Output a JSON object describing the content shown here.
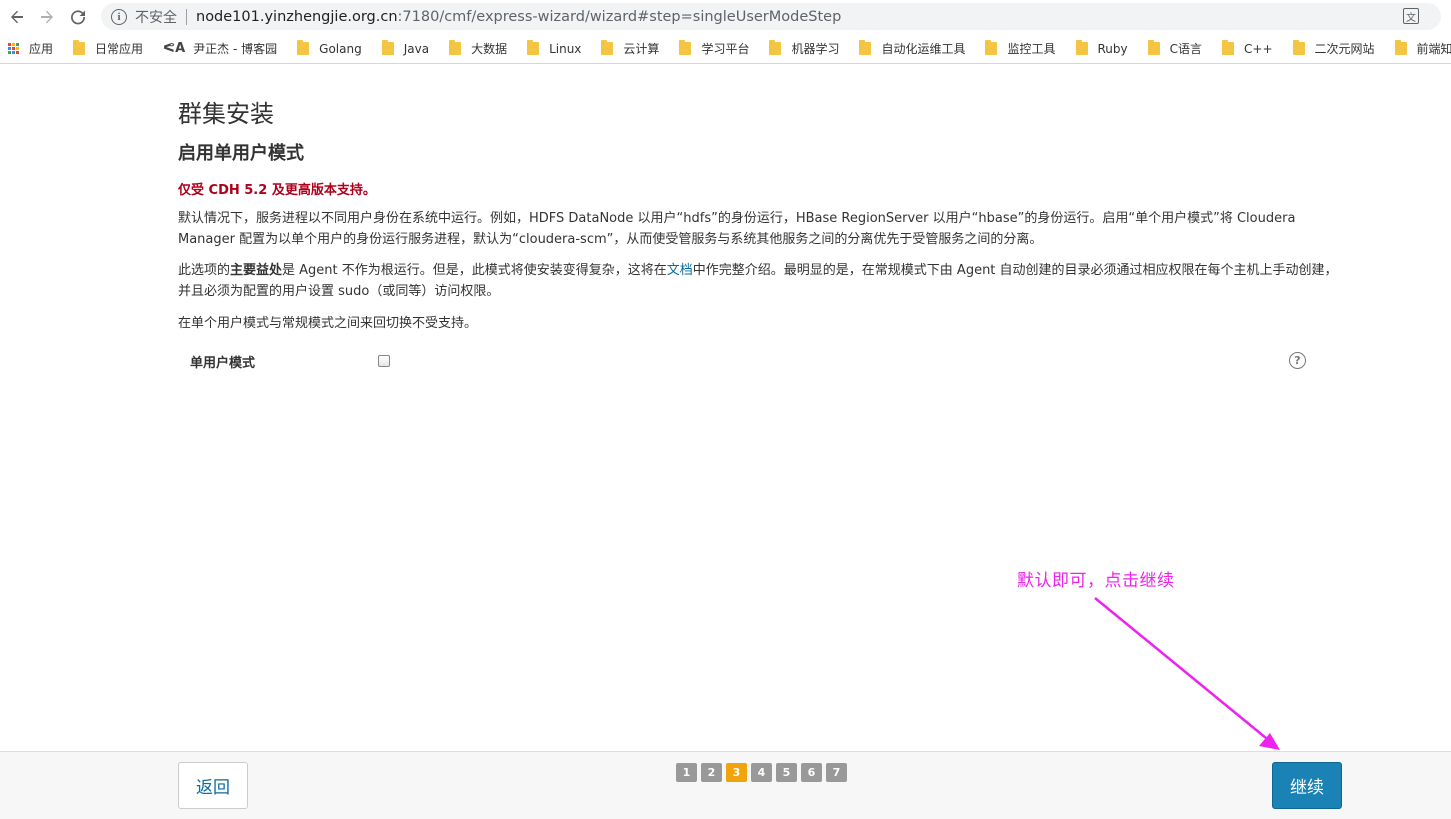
{
  "browser": {
    "security_label": "不安全",
    "url_host": "node101.yinzhengjie.org.cn",
    "url_rest": ":7180/cmf/express-wizard/wizard#step=singleUserModeStep"
  },
  "bookmarks": {
    "apps_label": "应用",
    "items": [
      "日常应用",
      "尹正杰 - 博客园",
      "Golang",
      "Java",
      "大数据",
      "Linux",
      "云计算",
      "学习平台",
      "机器学习",
      "自动化运维工具",
      "监控工具",
      "Ruby",
      "C语言",
      "C++",
      "二次元网站",
      "前端知识扫盲"
    ]
  },
  "page": {
    "title": "群集安装",
    "step_title": "启用单用户模式",
    "warning": "仅受 CDH 5.2 及更高版本支持。",
    "p1": "默认情况下，服务进程以不同用户身份在系统中运行。例如，HDFS DataNode 以用户“hdfs”的身份运行，HBase RegionServer 以用户“hbase”的身份运行。启用“单个用户模式”将 Cloudera Manager 配置为以单个用户的身份运行服务进程，默认为“cloudera-scm”，从而使受管服务与系统其他服务之间的分离优先于受管服务之间的分离。",
    "p2_a": "此选项的",
    "p2_bold": "主要益处",
    "p2_b": "是 Agent 不作为根运行。但是，此模式将使安装变得复杂，这将在",
    "p2_link": "文档",
    "p2_c": "中作完整介绍。最明显的是，在常规模式下由 Agent 自动创建的目录必须通过相应权限在每个主机上手动创建，并且必须为配置的用户设置 sudo（或同等）访问权限。",
    "p3": "在单个用户模式与常规模式之间来回切换不受支持。",
    "config_label": "单用户模式",
    "single_user_checked": false
  },
  "annotation": {
    "text": "默认即可，点击继续",
    "color": "#ee22ee"
  },
  "footer": {
    "back_label": "返回",
    "continue_label": "继续",
    "steps": [
      "1",
      "2",
      "3",
      "4",
      "5",
      "6",
      "7"
    ],
    "active_step": "3"
  }
}
